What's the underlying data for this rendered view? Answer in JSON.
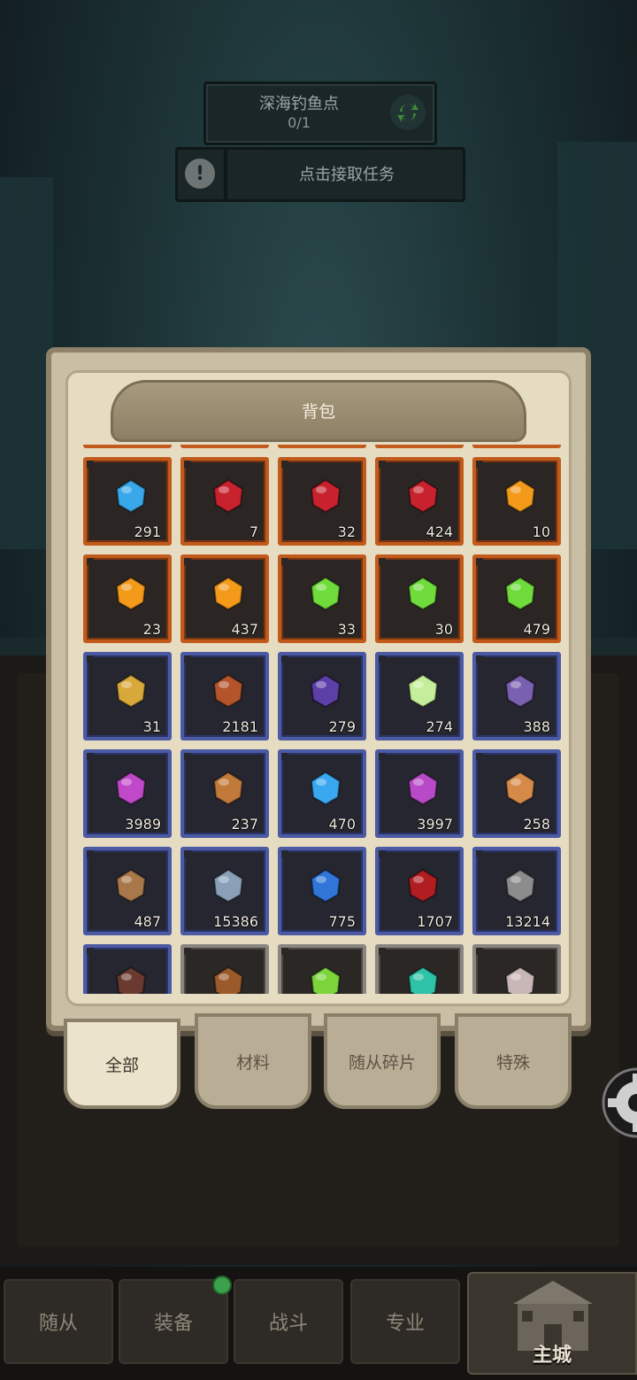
{
  "quest": {
    "title": "深海钓鱼点",
    "progress": "0/1",
    "task_label": "点击接取任务"
  },
  "bag": {
    "title": "背包",
    "items": [
      {
        "icon": "blue-crystal-icon",
        "count": "291",
        "rarity": "orange"
      },
      {
        "icon": "red-ore-icon",
        "count": "7",
        "rarity": "orange"
      },
      {
        "icon": "red-ore-icon",
        "count": "32",
        "rarity": "orange"
      },
      {
        "icon": "red-ore-icon",
        "count": "424",
        "rarity": "orange"
      },
      {
        "icon": "fire-orb-icon",
        "count": "10",
        "rarity": "orange"
      },
      {
        "icon": "fire-orb-icon",
        "count": "23",
        "rarity": "orange"
      },
      {
        "icon": "fire-orb-icon",
        "count": "437",
        "rarity": "orange"
      },
      {
        "icon": "green-gem-ore-icon",
        "count": "33",
        "rarity": "orange"
      },
      {
        "icon": "green-gem-ore-icon",
        "count": "30",
        "rarity": "orange"
      },
      {
        "icon": "green-gem-ore-icon",
        "count": "479",
        "rarity": "orange"
      },
      {
        "icon": "gold-emblem-icon",
        "count": "31",
        "rarity": "blue"
      },
      {
        "icon": "bronze-armor-icon",
        "count": "2181",
        "rarity": "blue"
      },
      {
        "icon": "purple-armor-icon",
        "count": "279",
        "rarity": "blue"
      },
      {
        "icon": "green-slime-icon",
        "count": "274",
        "rarity": "blue"
      },
      {
        "icon": "purple-gauntlet-icon",
        "count": "388",
        "rarity": "blue"
      },
      {
        "icon": "magenta-armor-icon",
        "count": "3989",
        "rarity": "blue"
      },
      {
        "icon": "tribal-mask-icon",
        "count": "237",
        "rarity": "blue"
      },
      {
        "icon": "frost-orb-icon",
        "count": "470",
        "rarity": "blue"
      },
      {
        "icon": "magenta-cape-icon",
        "count": "3997",
        "rarity": "blue"
      },
      {
        "icon": "orange-stone-icon",
        "count": "258",
        "rarity": "blue"
      },
      {
        "icon": "brown-rock-icon",
        "count": "487",
        "rarity": "blue"
      },
      {
        "icon": "horned-helmet-icon",
        "count": "15386",
        "rarity": "blue"
      },
      {
        "icon": "blue-rune-icon",
        "count": "775",
        "rarity": "blue"
      },
      {
        "icon": "red-shield-icon",
        "count": "1707",
        "rarity": "blue"
      },
      {
        "icon": "iron-helmet-icon",
        "count": "13214",
        "rarity": "blue"
      },
      {
        "icon": "lava-rock-icon",
        "count": "",
        "rarity": "blue"
      },
      {
        "icon": "brown-bag-icon",
        "count": "",
        "rarity": "gray"
      },
      {
        "icon": "green-leaf-icon",
        "count": "",
        "rarity": "gray"
      },
      {
        "icon": "teal-crystal-icon",
        "count": "",
        "rarity": "gray"
      },
      {
        "icon": "pale-stone-icon",
        "count": "",
        "rarity": "gray"
      }
    ],
    "tabs": [
      "全部",
      "材料",
      "随从碎片",
      "特殊"
    ],
    "active_tab": "全部"
  },
  "nav": {
    "items": [
      "随从",
      "装备",
      "战斗",
      "专业"
    ],
    "main": "主城"
  },
  "colors": {
    "rarity_orange": "#c15a1b",
    "rarity_blue": "#4b5aa3",
    "rarity_gray": "#8a8580",
    "panel": "#e6dcc2"
  }
}
